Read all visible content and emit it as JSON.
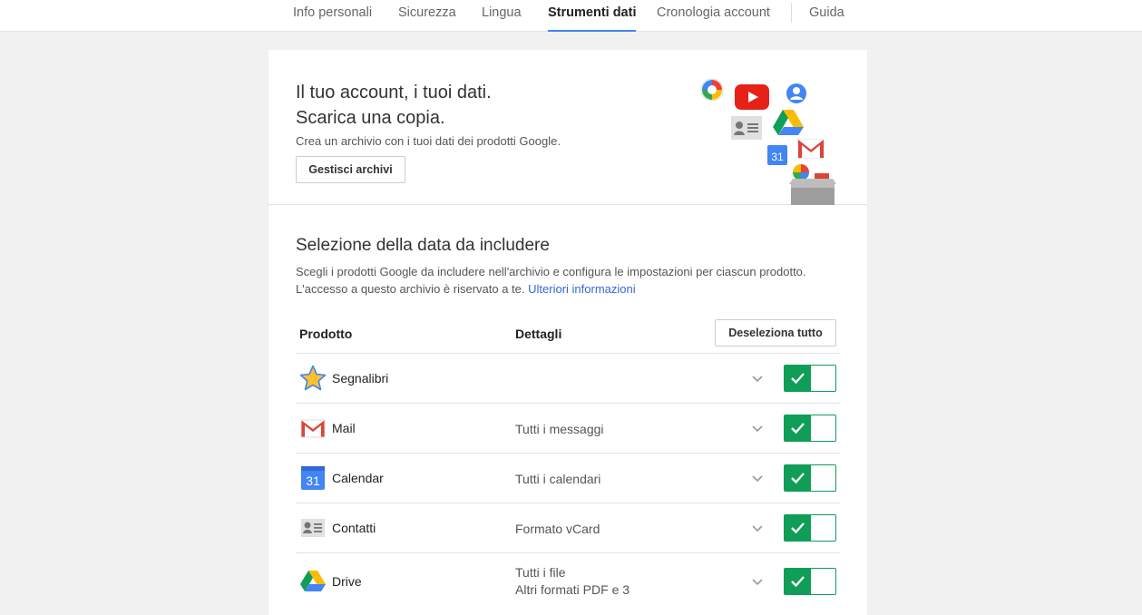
{
  "nav": {
    "tabs": [
      {
        "label": "Info personali",
        "active": false
      },
      {
        "label": "Sicurezza",
        "active": false
      },
      {
        "label": "Lingua",
        "active": false
      },
      {
        "label": "Strumenti dati",
        "active": true
      },
      {
        "label": "Cronologia account",
        "active": false
      },
      {
        "label": "Guida",
        "active": false
      }
    ]
  },
  "hero": {
    "title_line1": "Il tuo account, i tuoi dati.",
    "title_line2": "Scarica una copia.",
    "description": "Crea un archivio con i tuoi dati dei prodotti Google.",
    "manage_button": "Gestisci archivi"
  },
  "selection": {
    "title": "Selezione della data da includere",
    "desc_line1": "Scegli i prodotti Google da includere nell'archivio e configura le impostazioni per ciascun prodotto.",
    "desc_line2": "L'accesso a questo archivio è riservato a te.",
    "more_info_link": "Ulteriori informazioni"
  },
  "table": {
    "col_product": "Prodotto",
    "col_details": "Dettagli",
    "deselect_button": "Deseleziona tutto",
    "rows": [
      {
        "icon": "star-icon",
        "name": "Segnalibri",
        "details": "",
        "details2": "",
        "selected": true
      },
      {
        "icon": "gmail-icon",
        "name": "Mail",
        "details": "Tutti i messaggi",
        "details2": "",
        "selected": true
      },
      {
        "icon": "calendar-icon",
        "name": "Calendar",
        "details": "Tutti i calendari",
        "details2": "",
        "selected": true
      },
      {
        "icon": "contacts-icon",
        "name": "Contatti",
        "details": "Formato vCard",
        "details2": "",
        "selected": true
      },
      {
        "icon": "drive-icon",
        "name": "Drive",
        "details": "Tutti i file",
        "details2": "Altri formati PDF e 3",
        "selected": true
      }
    ]
  },
  "colors": {
    "accent_blue": "#4285f4",
    "toggle_green": "#0f9d58",
    "link_blue": "#3367d6"
  }
}
